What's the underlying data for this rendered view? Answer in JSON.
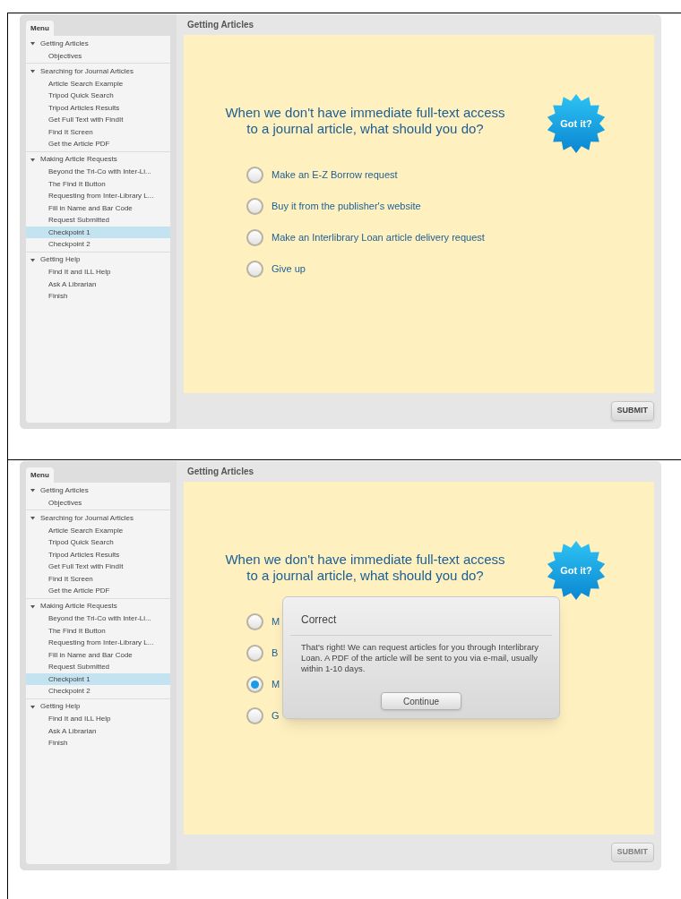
{
  "panels": [
    {
      "menu_title": "Menu",
      "sections": [
        {
          "label": "Getting Articles",
          "expanded": true,
          "items": [
            {
              "label": "Objectives",
              "selected": false
            }
          ]
        },
        {
          "label": "Searching for Journal Articles",
          "expanded": true,
          "items": [
            {
              "label": "Article Search Example",
              "selected": false
            },
            {
              "label": "Tripod Quick Search",
              "selected": false
            },
            {
              "label": "Tripod Articles Results",
              "selected": false
            },
            {
              "label": "Get Full Text with FindIt",
              "selected": false
            },
            {
              "label": "Find It Screen",
              "selected": false
            },
            {
              "label": "Get the Article PDF",
              "selected": false
            }
          ]
        },
        {
          "label": "Making Article Requests",
          "expanded": true,
          "items": [
            {
              "label": "Beyond the Tri-Co with Inter-Li...",
              "selected": false
            },
            {
              "label": "The Find It Button",
              "selected": false
            },
            {
              "label": "Requesting from Inter-Library L...",
              "selected": false
            },
            {
              "label": "Fill in Name and Bar Code",
              "selected": false
            },
            {
              "label": "Request Submitted",
              "selected": false
            },
            {
              "label": "Checkpoint 1",
              "selected": true
            },
            {
              "label": "Checkpoint 2",
              "selected": false
            }
          ]
        },
        {
          "label": "Getting Help",
          "expanded": true,
          "items": [
            {
              "label": "Find It and ILL Help",
              "selected": false
            },
            {
              "label": "Ask A Librarian",
              "selected": false
            },
            {
              "label": "Finish",
              "selected": false
            }
          ]
        }
      ],
      "title": "Getting Articles",
      "question": "When we don't have immediate full-text access to a journal article, what should you do?",
      "got_it": "Got it?",
      "options": [
        {
          "label": "Make an E-Z Borrow request",
          "selected": false
        },
        {
          "label": "Buy it from the publisher's website",
          "selected": false
        },
        {
          "label": "Make an Interlibrary Loan article delivery request",
          "selected": false
        },
        {
          "label": "Give up",
          "selected": false
        }
      ],
      "submit": {
        "label": "SUBMIT",
        "disabled": false
      }
    },
    {
      "menu_title": "Menu",
      "sections": [
        {
          "label": "Getting Articles",
          "expanded": true,
          "items": [
            {
              "label": "Objectives",
              "selected": false
            }
          ]
        },
        {
          "label": "Searching for Journal Articles",
          "expanded": true,
          "items": [
            {
              "label": "Article Search Example",
              "selected": false
            },
            {
              "label": "Tripod Quick Search",
              "selected": false
            },
            {
              "label": "Tripod Articles Results",
              "selected": false
            },
            {
              "label": "Get Full Text with FindIt",
              "selected": false
            },
            {
              "label": "Find It Screen",
              "selected": false
            },
            {
              "label": "Get the Article PDF",
              "selected": false
            }
          ]
        },
        {
          "label": "Making Article Requests",
          "expanded": true,
          "items": [
            {
              "label": "Beyond the Tri-Co with Inter-Li...",
              "selected": false
            },
            {
              "label": "The Find It Button",
              "selected": false
            },
            {
              "label": "Requesting from Inter-Library L...",
              "selected": false
            },
            {
              "label": "Fill in Name and Bar Code",
              "selected": false
            },
            {
              "label": "Request Submitted",
              "selected": false
            },
            {
              "label": "Checkpoint 1",
              "selected": true
            },
            {
              "label": "Checkpoint 2",
              "selected": false
            }
          ]
        },
        {
          "label": "Getting Help",
          "expanded": true,
          "items": [
            {
              "label": "Find It and ILL Help",
              "selected": false
            },
            {
              "label": "Ask A Librarian",
              "selected": false
            },
            {
              "label": "Finish",
              "selected": false
            }
          ]
        }
      ],
      "title": "Getting Articles",
      "question": "When we don't have immediate full-text access to a journal article, what should you do?",
      "got_it": "Got it?",
      "options": [
        {
          "label": "M",
          "selected": false
        },
        {
          "label": "B",
          "selected": false
        },
        {
          "label": "M",
          "selected": true
        },
        {
          "label": "G",
          "selected": false
        }
      ],
      "submit": {
        "label": "SUBMIT",
        "disabled": true
      },
      "dialog": {
        "title": "Correct",
        "message": "That's right!  We can request articles for you through Interlibrary Loan. A PDF of the article will be sent to you via e-mail, usually within 1-10 days.",
        "button": "Continue"
      }
    }
  ]
}
